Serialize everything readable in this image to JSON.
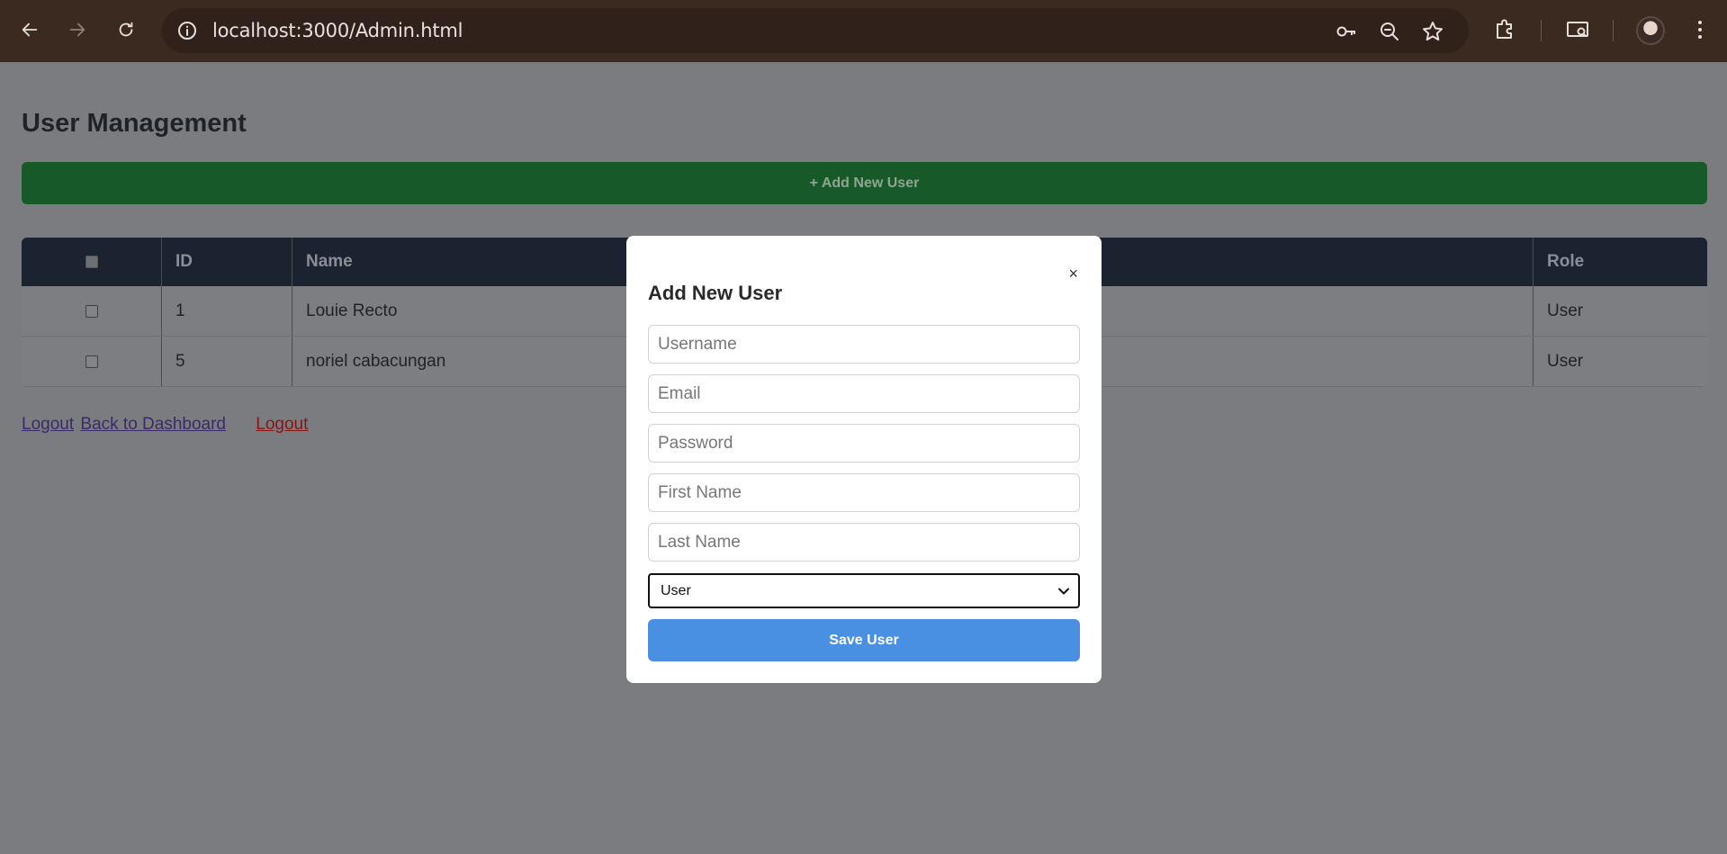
{
  "browser": {
    "url": "localhost:3000/Admin.html",
    "icons": [
      "back-arrow-icon",
      "forward-arrow-icon",
      "reload-icon",
      "site-info-icon",
      "password-key-icon",
      "zoom-out-icon",
      "bookmark-star-icon",
      "extensions-icon",
      "media-router-icon",
      "profile-avatar",
      "more-menu-icon"
    ]
  },
  "page": {
    "title": "User Management",
    "add_button": "+ Add New User",
    "table": {
      "headers": [
        "",
        "ID",
        "Name",
        "Role"
      ],
      "rows": [
        {
          "id": "1",
          "name": "Louie Recto",
          "role": "User"
        },
        {
          "id": "5",
          "name": "noriel cabacungan",
          "role": "User"
        }
      ]
    },
    "links": {
      "logout1": "Logout",
      "dashboard": "Back to Dashboard",
      "logout2": "Logout"
    }
  },
  "modal": {
    "title": "Add New User",
    "close": "×",
    "fields": {
      "username": "Username",
      "email": "Email",
      "password": "Password",
      "first_name": "First Name",
      "last_name": "Last Name"
    },
    "role_selected": "User",
    "save_button": "Save User"
  },
  "colors": {
    "add_button": "#18592a",
    "save_button": "#4a90e2",
    "table_header": "#1b2331",
    "overlay": "#7b7c7f"
  }
}
